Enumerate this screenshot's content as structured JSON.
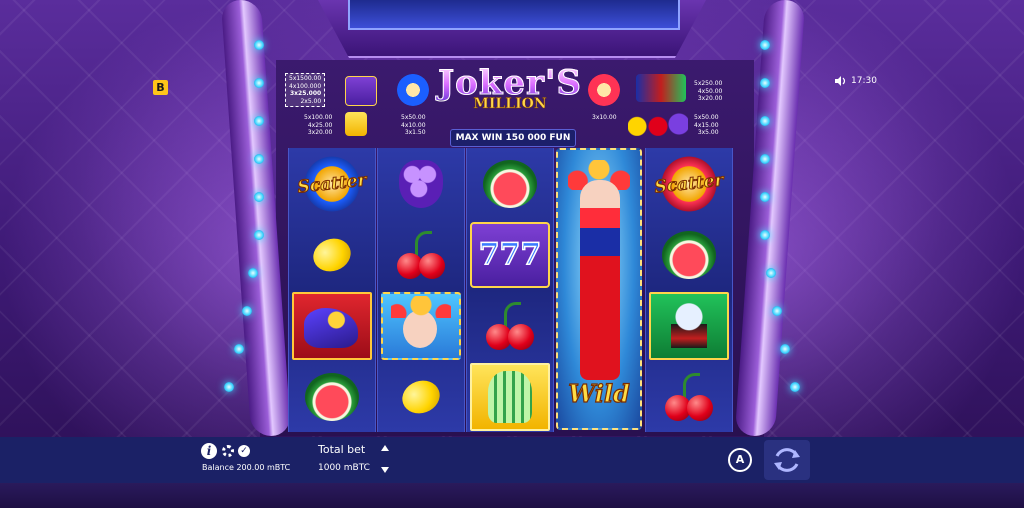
{
  "game": {
    "title_line1": "Joker'S",
    "title_line2": "MILLION",
    "max_win": "MAX WIN 150 000 FUN"
  },
  "header": {
    "badge": "B",
    "time": "17:30"
  },
  "paytable": {
    "sevens": [
      "5x1500.00",
      "4x100.000",
      "3x25.000",
      "2x5.00"
    ],
    "bowling": [
      "5x100.00",
      "4x25.00",
      "3x20.00"
    ],
    "scatter_left": [
      "5x50.00",
      "4x10.00",
      "3x1.50"
    ],
    "scatter_right": [
      "3x10.00"
    ],
    "joker": [
      "5x250.00",
      "4x50.00",
      "3x20.00"
    ],
    "fruits": [
      "5x50.00",
      "4x15.00",
      "3x5.00"
    ]
  },
  "reels": {
    "scatter_label": "Scatter",
    "wild_label": "Wild",
    "sevens_label": "777",
    "columns": [
      [
        "scatter-blue",
        "lemon",
        "shoe",
        "watermelon"
      ],
      [
        "grapes",
        "cherries",
        "joker-portrait",
        "lemon"
      ],
      [
        "watermelon",
        "sevens",
        "cherries",
        "bowling"
      ],
      [
        "wild-jester"
      ],
      [
        "scatter-red",
        "watermelon",
        "rabbit-hat",
        "cherries"
      ]
    ]
  },
  "bottom_bar": {
    "info_label": "i",
    "check_label": "✓",
    "balance": "Balance 200.00 mBTC",
    "total_bet_label": "Total bet",
    "total_bet_value": "1000 mBTC",
    "auto_label": "A"
  },
  "colors": {
    "bar_bg": "#1b2166",
    "accent_gold": "#ffdc45",
    "reel_bg": "#1e2780"
  }
}
